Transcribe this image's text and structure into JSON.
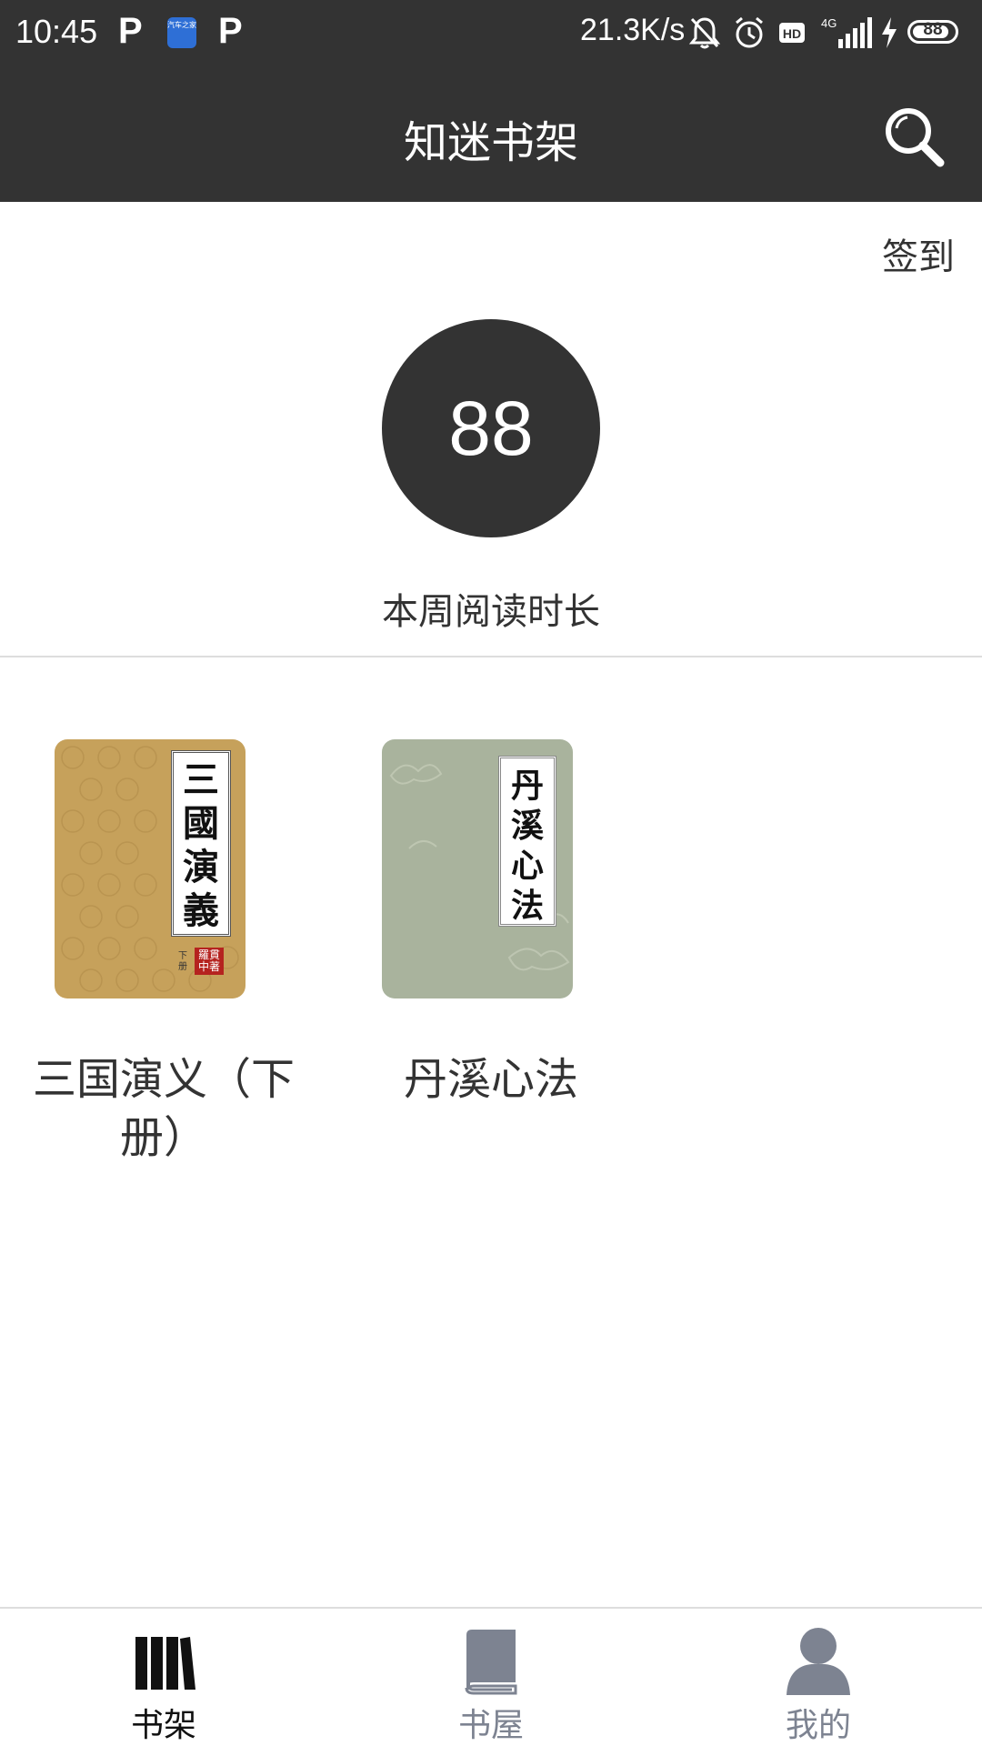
{
  "status_bar": {
    "time": "10:45",
    "p_icon_1": "P",
    "app_icon_text": "汽车之家",
    "p_icon_2": "P",
    "network_speed": "21.3K/s",
    "network_type": "4G",
    "battery_level": "88",
    "battery_fraction": 0.88,
    "icons": [
      "mute-bell-icon",
      "alarm-icon",
      "hd-icon",
      "signal-icon",
      "charging-icon",
      "battery-icon"
    ]
  },
  "header": {
    "title": "知迷书架",
    "search_icon": "search-icon"
  },
  "checkin": {
    "label": "签到"
  },
  "reading": {
    "minutes": "88",
    "label": "本周阅读时长"
  },
  "books": [
    {
      "title": "三国演义（下册）",
      "cover_title": "三國演義",
      "cover_author": "羅貫中著",
      "cover_volume": "下册",
      "cover_color": "#c6a15b"
    },
    {
      "title": "丹溪心法",
      "cover_title": "丹溪心法",
      "cover_color": "#a9b39d"
    }
  ],
  "bottom_nav": [
    {
      "label": "书架",
      "icon": "bookshelf-icon",
      "active": true
    },
    {
      "label": "书屋",
      "icon": "book-icon",
      "active": false
    },
    {
      "label": "我的",
      "icon": "user-icon",
      "active": false
    }
  ],
  "colors": {
    "header_bg": "#333333",
    "circle_bg": "#333333",
    "nav_active": "#111111",
    "nav_inactive": "#7d8391"
  }
}
